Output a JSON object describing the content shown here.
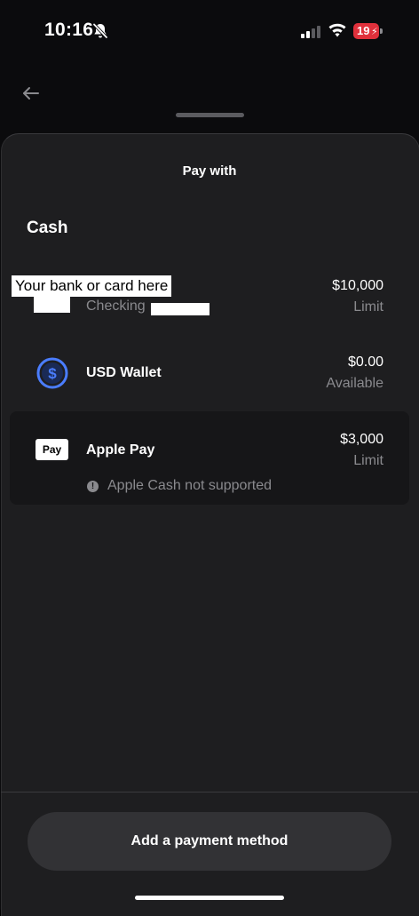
{
  "status_bar": {
    "time": "10:16",
    "battery_level": "19",
    "battery_color": "#e0303b",
    "icons": [
      "bell-slash-icon",
      "signal-icon",
      "wifi-icon",
      "battery-charging-icon"
    ]
  },
  "header": {
    "back_icon": "arrow-left-icon"
  },
  "sheet": {
    "title": "Pay with",
    "section_heading": "Cash",
    "methods": [
      {
        "redaction_label": "Your bank or card here",
        "sub": "Checking",
        "amount": "$10,000",
        "amount_sub": "Limit"
      },
      {
        "name": "USD Wallet",
        "icon": "dollar-circle-icon",
        "icon_color": "#4a7dff",
        "amount": "$0.00",
        "amount_sub": "Available"
      },
      {
        "name": "Apple Pay",
        "logo_text": "Pay",
        "amount": "$3,000",
        "amount_sub": "Limit",
        "notice": "Apple Cash not supported"
      }
    ]
  },
  "footer": {
    "add_button_label": "Add a payment method"
  }
}
